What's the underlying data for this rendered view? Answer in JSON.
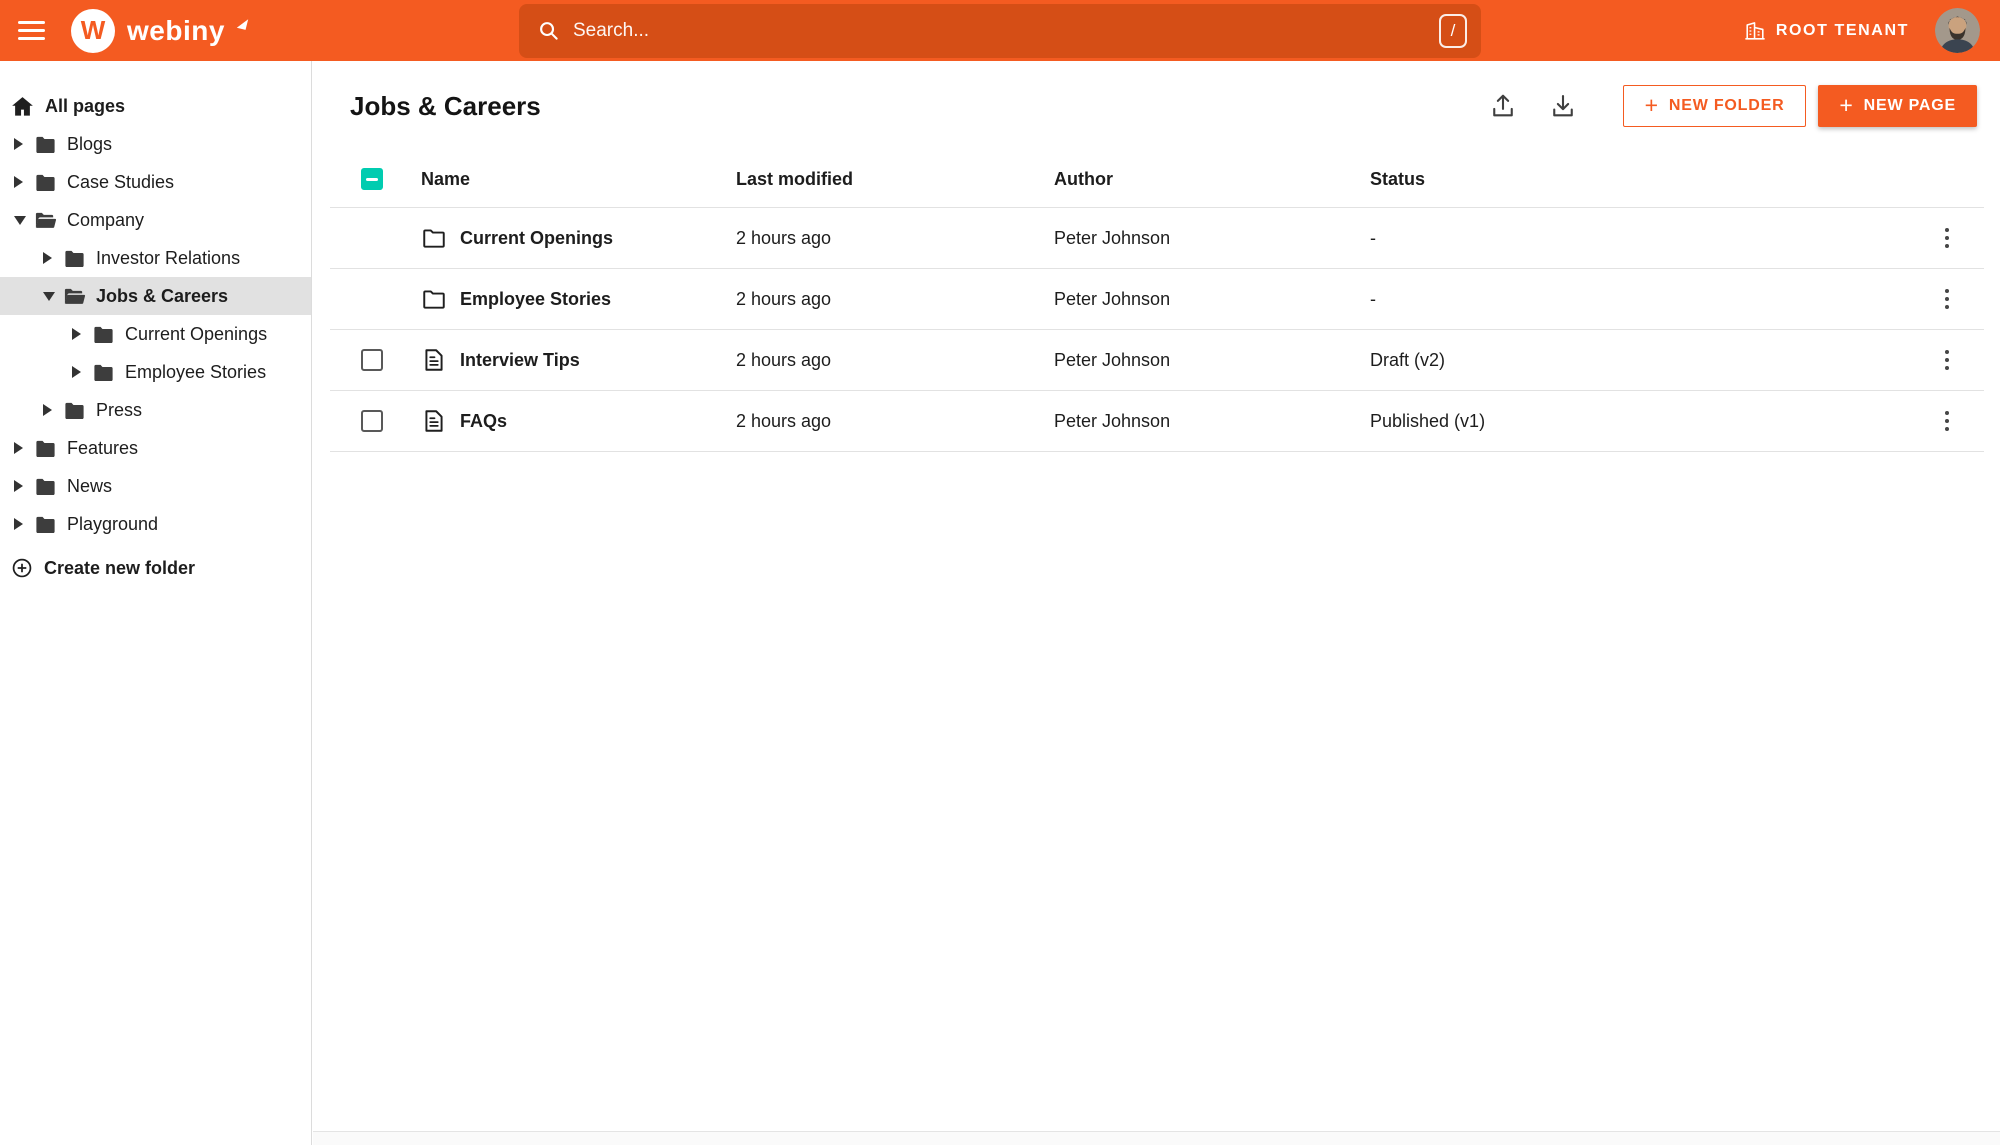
{
  "colors": {
    "brand": "#f45b21",
    "search_bg": "#d54e16",
    "teal": "#00ccb0",
    "selected_bg": "#e1e1e1",
    "border": "#e2e2e2"
  },
  "topbar": {
    "logo_text": "webiny",
    "logo_letter": "W",
    "search": {
      "placeholder": "Search...",
      "shortcut": "/"
    },
    "tenant": {
      "label": "ROOT TENANT"
    }
  },
  "sidebar": {
    "all_pages": "All pages",
    "items": [
      {
        "label": "Blogs",
        "level": 0,
        "state": "collapsed",
        "selected": false
      },
      {
        "label": "Case Studies",
        "level": 0,
        "state": "collapsed",
        "selected": false
      },
      {
        "label": "Company",
        "level": 0,
        "state": "expanded",
        "selected": false
      },
      {
        "label": "Investor Relations",
        "level": 1,
        "state": "collapsed",
        "selected": false
      },
      {
        "label": "Jobs & Careers",
        "level": 1,
        "state": "expanded",
        "selected": true
      },
      {
        "label": "Current Openings",
        "level": 2,
        "state": "collapsed",
        "selected": false
      },
      {
        "label": "Employee Stories",
        "level": 2,
        "state": "collapsed",
        "selected": false
      },
      {
        "label": "Press",
        "level": 1,
        "state": "collapsed",
        "selected": false
      },
      {
        "label": "Features",
        "level": 0,
        "state": "collapsed",
        "selected": false
      },
      {
        "label": "News",
        "level": 0,
        "state": "collapsed",
        "selected": false
      },
      {
        "label": "Playground",
        "level": 0,
        "state": "collapsed",
        "selected": false
      }
    ],
    "create_new_folder": "Create new folder"
  },
  "main": {
    "title": "Jobs & Careers",
    "buttons": {
      "new_folder": {
        "icon": "+",
        "label": "NEW FOLDER"
      },
      "new_page": {
        "icon": "+",
        "label": "NEW PAGE"
      }
    },
    "table": {
      "columns": [
        "Name",
        "Last modified",
        "Author",
        "Status"
      ],
      "select_all_state": "indeterminate",
      "rows": [
        {
          "kind": "folder",
          "has_checkbox": false,
          "checked": false,
          "name": "Current Openings",
          "last_modified": "2 hours ago",
          "author": "Peter Johnson",
          "status": "-"
        },
        {
          "kind": "folder",
          "has_checkbox": false,
          "checked": false,
          "name": "Employee Stories",
          "last_modified": "2 hours ago",
          "author": "Peter Johnson",
          "status": "-"
        },
        {
          "kind": "page",
          "has_checkbox": true,
          "checked": false,
          "name": "Interview Tips",
          "last_modified": "2 hours ago",
          "author": "Peter Johnson",
          "status": "Draft (v2)"
        },
        {
          "kind": "page",
          "has_checkbox": true,
          "checked": false,
          "name": "FAQs",
          "last_modified": "2 hours ago",
          "author": "Peter Johnson",
          "status": "Published (v1)"
        }
      ]
    }
  }
}
